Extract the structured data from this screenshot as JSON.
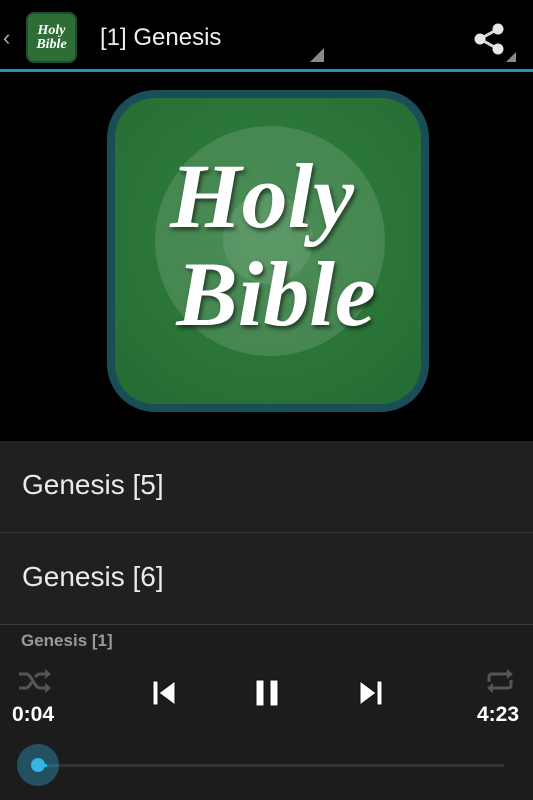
{
  "action_bar": {
    "up_glyph": "‹",
    "app_icon": {
      "line1": "Holy",
      "line2": "Bible"
    },
    "title": "[1] Genesis",
    "share_icon": "share-icon"
  },
  "artwork": {
    "line1": "Holy",
    "line2": "Bible"
  },
  "list": {
    "items": [
      {
        "label": "Genesis [5]"
      },
      {
        "label": "Genesis [6]"
      }
    ]
  },
  "player": {
    "now_playing": "Genesis [1]",
    "elapsed": "0:04",
    "duration": "4:23",
    "progress_fraction": 0.015,
    "controls": [
      "shuffle-icon",
      "previous-icon",
      "pause-icon",
      "next-icon",
      "repeat-icon"
    ]
  },
  "colors": {
    "accent": "#33b5e5",
    "actionbar_divider": "#2f8fb0",
    "list_background": "#202020",
    "icon_green": "#2e6e34"
  }
}
